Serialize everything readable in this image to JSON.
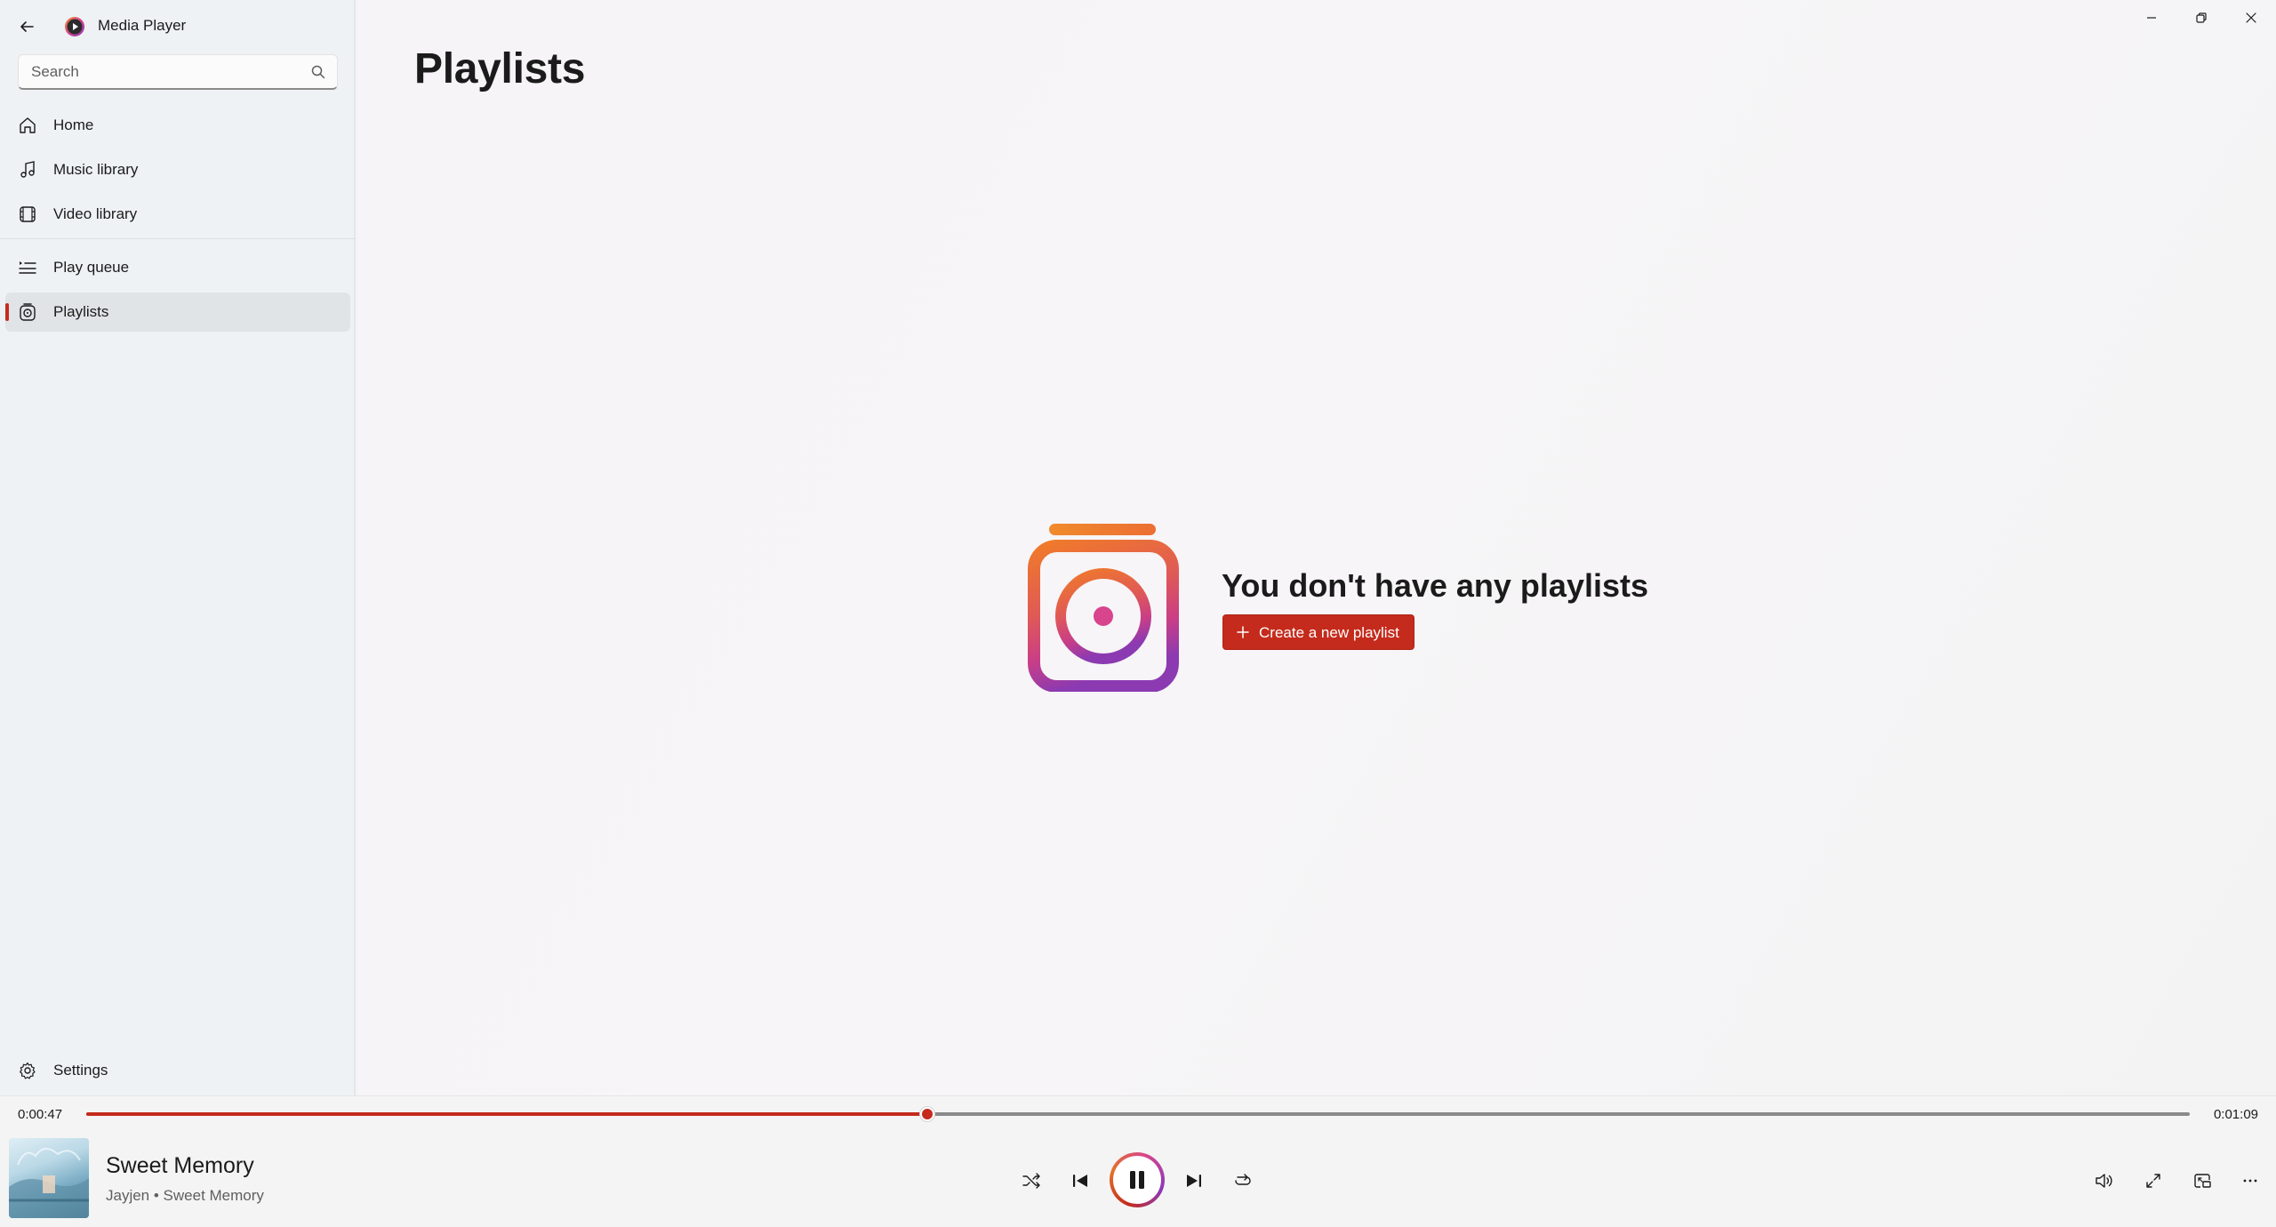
{
  "app": {
    "title": "Media Player"
  },
  "search": {
    "placeholder": "Search"
  },
  "sidebar": {
    "items": [
      {
        "label": "Home",
        "icon": "home-icon"
      },
      {
        "label": "Music library",
        "icon": "music-note-icon"
      },
      {
        "label": "Video library",
        "icon": "film-icon"
      },
      {
        "label": "Play queue",
        "icon": "queue-icon"
      },
      {
        "label": "Playlists",
        "icon": "playlist-icon",
        "active": true
      }
    ],
    "settings_label": "Settings"
  },
  "main": {
    "page_title": "Playlists",
    "empty_heading": "You don't have any playlists",
    "create_button": "Create a new playlist"
  },
  "player": {
    "current_time": "0:00:47",
    "total_time": "0:01:09",
    "progress": 0.4,
    "song_title": "Sweet Memory",
    "song_subtitle": "Jayjen • Sweet Memory",
    "state": "playing"
  },
  "colors": {
    "accent": "#c42b1c",
    "sidebar_bg": "#eef2f5",
    "active_item_bg": "#e1e4e7"
  }
}
